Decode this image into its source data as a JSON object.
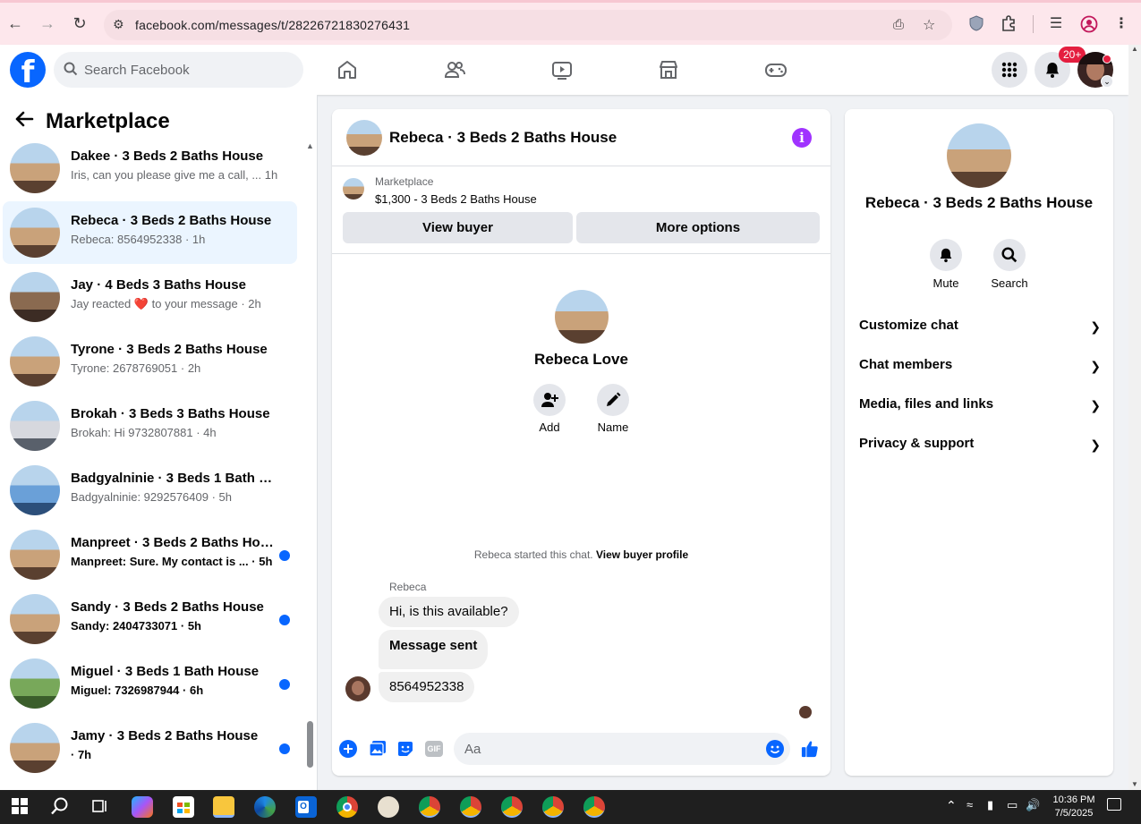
{
  "browser": {
    "url": "facebook.com/messages/t/28226721830276431"
  },
  "header": {
    "logo": "f",
    "search_placeholder": "Search Facebook",
    "notification_badge": "20+"
  },
  "sidebar": {
    "title": "Marketplace",
    "conversations": [
      {
        "name": "Dakee · 3 Beds 2 Baths House",
        "snippet": "Iris, can you please give me a call, ... ",
        "time": "1h",
        "unread": false,
        "active": false
      },
      {
        "name": "Rebeca · 3 Beds 2 Baths House",
        "snippet": "Rebeca: 8564952338 · ",
        "time": "1h",
        "unread": false,
        "active": true
      },
      {
        "name": "Jay · 4 Beds 3 Baths House",
        "snippet": "Jay reacted ❤️ to your message · ",
        "time": "2h",
        "unread": false,
        "active": false
      },
      {
        "name": "Tyrone · 3 Beds 2 Baths House",
        "snippet": "Tyrone: 2678769051 · ",
        "time": "2h",
        "unread": false,
        "active": false
      },
      {
        "name": "Brokah · 3 Beds 3 Baths House",
        "snippet": "Brokah: Hi 9732807881 · ",
        "time": "4h",
        "unread": false,
        "active": false
      },
      {
        "name": "Badgyalninie · 3 Beds 1 Bath Ho...",
        "snippet": "Badgyalninie: 9292576409 · ",
        "time": "5h",
        "unread": false,
        "active": false
      },
      {
        "name": "Manpreet · 3 Beds 2 Baths Hou...",
        "snippet": "Manpreet: Sure. My contact is ... · ",
        "time": "5h",
        "unread": true,
        "active": false
      },
      {
        "name": "Sandy · 3 Beds 2 Baths House",
        "snippet": "Sandy: 2404733071 · ",
        "time": "5h",
        "unread": true,
        "active": false
      },
      {
        "name": "Miguel · 3 Beds 1 Bath House",
        "snippet": "Miguel: 7326987944 · ",
        "time": "6h",
        "unread": true,
        "active": false
      },
      {
        "name": "Jamy · 3 Beds 2 Baths House",
        "snippet": " · ",
        "time": "7h",
        "unread": true,
        "active": false
      }
    ]
  },
  "chat": {
    "title": "Rebeca · 3 Beds 2 Baths House",
    "listing_label": "Marketplace",
    "listing_price": "$1,300 - 3 Beds 2 Baths House",
    "view_buyer": "View buyer",
    "more_options": "More options",
    "profile_name": "Rebeca Love",
    "add_label": "Add",
    "name_label": "Name",
    "started_text": "Rebeca started this chat.",
    "view_profile": "View buyer profile",
    "sender": "Rebeca",
    "messages": [
      "Hi, is this available?",
      "Message sent",
      "8564952338"
    ],
    "input_placeholder": "Aa",
    "gif_label": "GIF"
  },
  "panel": {
    "name": "Rebeca · 3 Beds 2 Baths House",
    "mute": "Mute",
    "search": "Search",
    "sections": [
      "Customize chat",
      "Chat members",
      "Media, files and links",
      "Privacy & support"
    ]
  },
  "taskbar": {
    "time": "10:36 PM",
    "date": "7/5/2025"
  },
  "colors": {
    "fb_blue": "#0866ff",
    "info_purple": "#a033ff",
    "badge_red": "#e41e3f"
  }
}
